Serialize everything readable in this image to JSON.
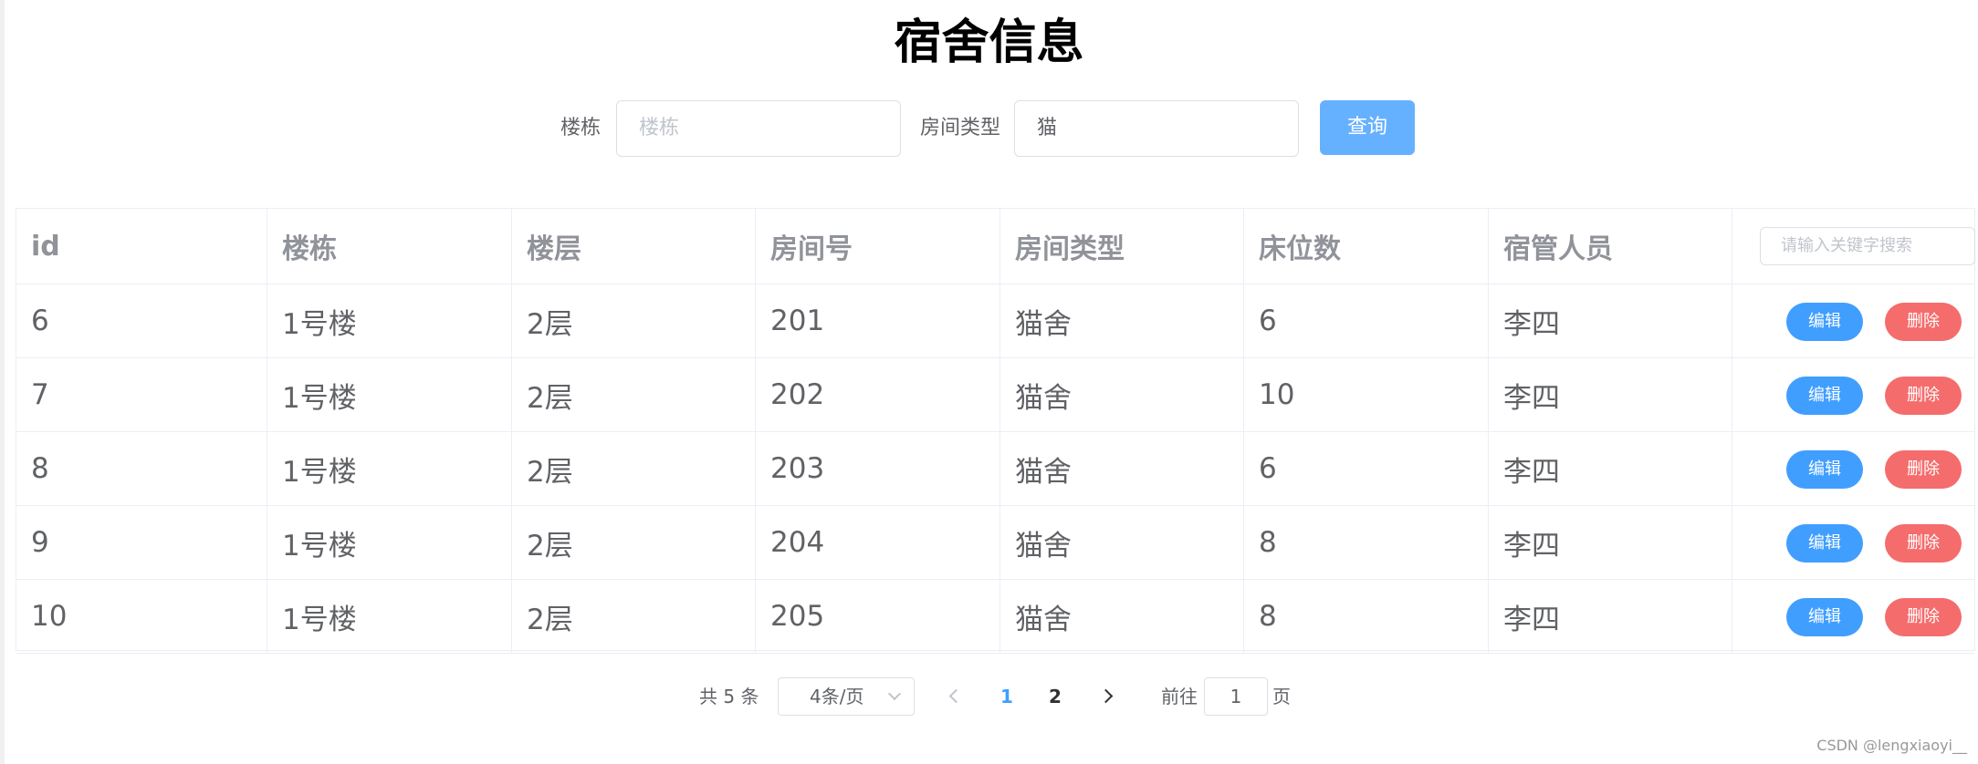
{
  "title": "宿舍信息",
  "search": {
    "building_label": "楼栋",
    "building_placeholder": "楼栋",
    "building_value": "",
    "room_type_label": "房间类型",
    "room_type_value": "猫",
    "query_label": "查询"
  },
  "table": {
    "columns": [
      "id",
      "楼栋",
      "楼层",
      "房间号",
      "房间类型",
      "床位数",
      "宿管人员"
    ],
    "search_placeholder": "请输入关键字搜索",
    "edit_label": "编辑",
    "delete_label": "删除",
    "rows": [
      [
        "6",
        "1号楼",
        "2层",
        "201",
        "猫舍",
        "6",
        "李四"
      ],
      [
        "7",
        "1号楼",
        "2层",
        "202",
        "猫舍",
        "10",
        "李四"
      ],
      [
        "8",
        "1号楼",
        "2层",
        "203",
        "猫舍",
        "6",
        "李四"
      ],
      [
        "9",
        "1号楼",
        "2层",
        "204",
        "猫舍",
        "8",
        "李四"
      ],
      [
        "10",
        "1号楼",
        "2层",
        "205",
        "猫舍",
        "8",
        "李四"
      ]
    ]
  },
  "pagination": {
    "total": "共 5 条",
    "page_size": "4条/页",
    "pages": [
      "1",
      "2"
    ],
    "current_page": "1",
    "goto_label": "前往",
    "goto_value": "1",
    "page_suffix": "页"
  },
  "watermark": "CSDN @lengxiaoyi__",
  "colors": {
    "primary": "#409eff",
    "primary_light": "#66b1ff",
    "danger": "#f56c6c",
    "border": "#ebeef5",
    "header_text": "#909399",
    "body_text": "#606266"
  }
}
